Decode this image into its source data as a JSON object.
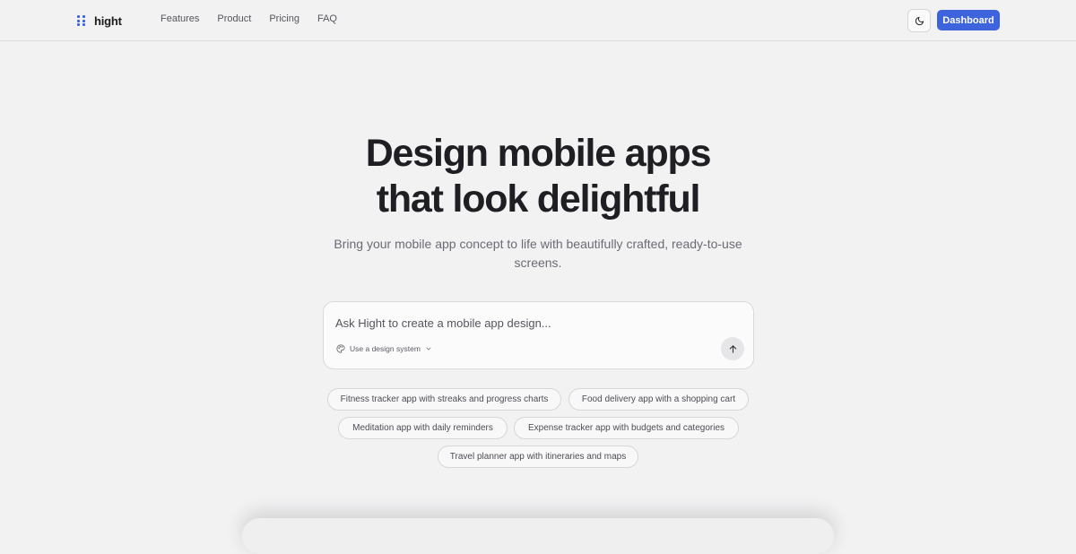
{
  "brand": {
    "name": "hight",
    "accent": "#3d63dd"
  },
  "nav": {
    "links": [
      "Features",
      "Product",
      "Pricing",
      "FAQ"
    ],
    "theme_toggle_icon": "moon-icon",
    "dashboard_label": "Dashboard"
  },
  "hero": {
    "title_line1": "Design mobile apps",
    "title_line2": "that look delightful",
    "subtitle": "Bring your mobile app concept to life with beautifully crafted, ready-to-use screens."
  },
  "prompt": {
    "placeholder": "Ask Hight to create a mobile app design...",
    "value": "",
    "design_system_label": "Use a design system",
    "design_system_icon": "palette-icon",
    "send_icon": "arrow-up-icon"
  },
  "suggestions": [
    "Fitness tracker app with streaks and progress charts",
    "Food delivery app with a shopping cart",
    "Meditation app with daily reminders",
    "Expense tracker app with budgets and categories",
    "Travel planner app with itineraries and maps"
  ]
}
